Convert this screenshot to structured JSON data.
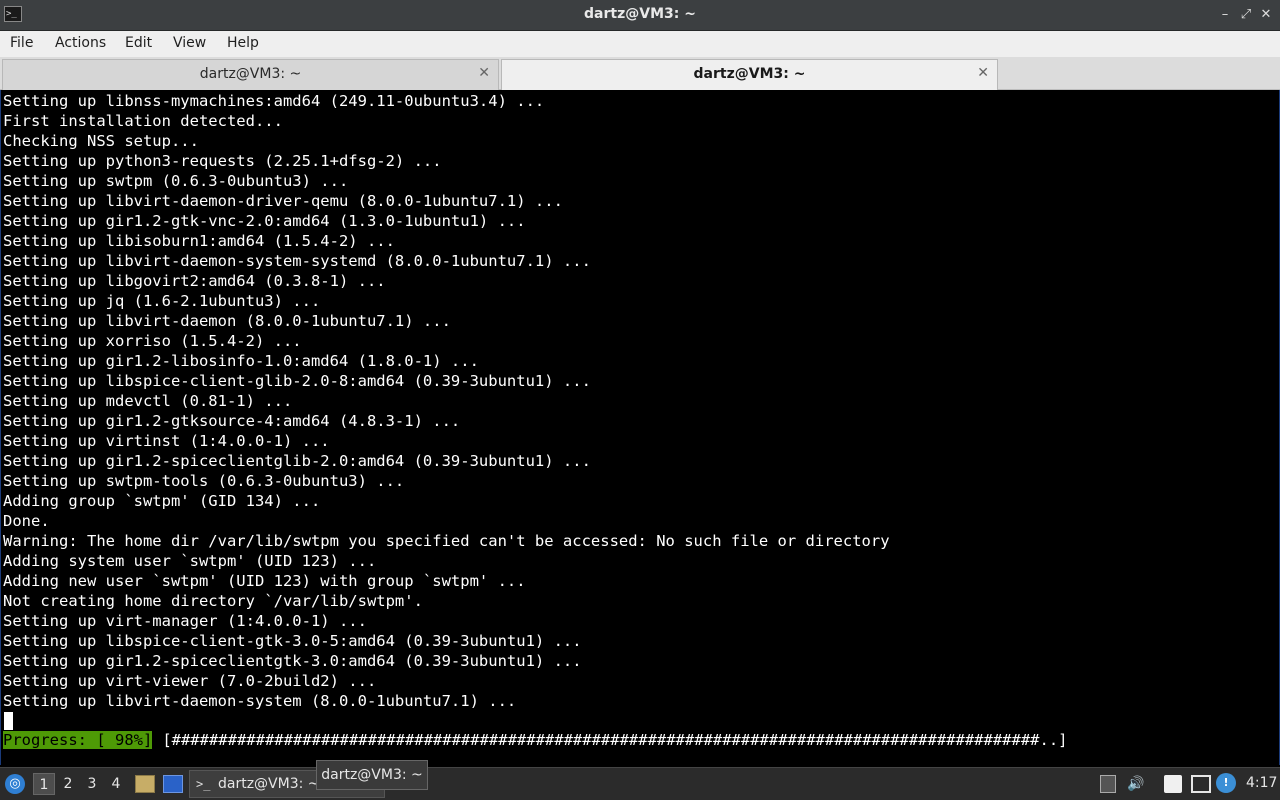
{
  "window": {
    "app_icon_glyph": ">_",
    "title": "dartz@VM3: ~",
    "controls": {
      "minimize": "–",
      "maximize": "⤢",
      "close": "✕"
    }
  },
  "menu": {
    "items": [
      "File",
      "Actions",
      "Edit",
      "View",
      "Help"
    ]
  },
  "tabs": [
    {
      "label": "dartz@VM3: ~",
      "active": false,
      "close": "✕"
    },
    {
      "label": "dartz@VM3: ~",
      "active": true,
      "close": "✕"
    }
  ],
  "terminal": {
    "lines": [
      "Setting up libnss-mymachines:amd64 (249.11-0ubuntu3.4) ...",
      "First installation detected...",
      "Checking NSS setup...",
      "Setting up python3-requests (2.25.1+dfsg-2) ...",
      "Setting up swtpm (0.6.3-0ubuntu3) ...",
      "Setting up libvirt-daemon-driver-qemu (8.0.0-1ubuntu7.1) ...",
      "Setting up gir1.2-gtk-vnc-2.0:amd64 (1.3.0-1ubuntu1) ...",
      "Setting up libisoburn1:amd64 (1.5.4-2) ...",
      "Setting up libvirt-daemon-system-systemd (8.0.0-1ubuntu7.1) ...",
      "Setting up libgovirt2:amd64 (0.3.8-1) ...",
      "Setting up jq (1.6-2.1ubuntu3) ...",
      "Setting up libvirt-daemon (8.0.0-1ubuntu7.1) ...",
      "Setting up xorriso (1.5.4-2) ...",
      "Setting up gir1.2-libosinfo-1.0:amd64 (1.8.0-1) ...",
      "Setting up libspice-client-glib-2.0-8:amd64 (0.39-3ubuntu1) ...",
      "Setting up mdevctl (0.81-1) ...",
      "Setting up gir1.2-gtksource-4:amd64 (4.8.3-1) ...",
      "Setting up virtinst (1:4.0.0-1) ...",
      "Setting up gir1.2-spiceclientglib-2.0:amd64 (0.39-3ubuntu1) ...",
      "Setting up swtpm-tools (0.6.3-0ubuntu3) ...",
      "Adding group `swtpm' (GID 134) ...",
      "Done.",
      "Warning: The home dir /var/lib/swtpm you specified can't be accessed: No such file or directory",
      "Adding system user `swtpm' (UID 123) ...",
      "Adding new user `swtpm' (UID 123) with group `swtpm' ...",
      "Not creating home directory `/var/lib/swtpm'.",
      "Setting up virt-manager (1:4.0.0-1) ...",
      "Setting up libspice-client-gtk-3.0-5:amd64 (0.39-3ubuntu1) ...",
      "Setting up gir1.2-spiceclientgtk-3.0:amd64 (0.39-3ubuntu1) ...",
      "Setting up virt-viewer (7.0-2build2) ...",
      "Setting up libvirt-daemon-system (8.0.0-1ubuntu7.1) ..."
    ],
    "progress_label": "Progress: [ 98%]",
    "progress_bar": "[#############################################################################################..]",
    "progress_percent": 98,
    "colors": {
      "foreground": "#ffffff",
      "background": "#000000",
      "progress_highlight": "#4e9a06"
    }
  },
  "taskbar": {
    "start_glyph": "◎",
    "workspaces": [
      "1",
      "2",
      "3",
      "4"
    ],
    "active_workspace": "1",
    "task": {
      "icon_glyph": ">_",
      "label": "dartz@VM3: ~"
    },
    "tooltip": "dartz@VM3: ~",
    "tray": {
      "volume_glyph": "🔊",
      "updates_glyph": "!"
    },
    "clock": "4:17"
  }
}
